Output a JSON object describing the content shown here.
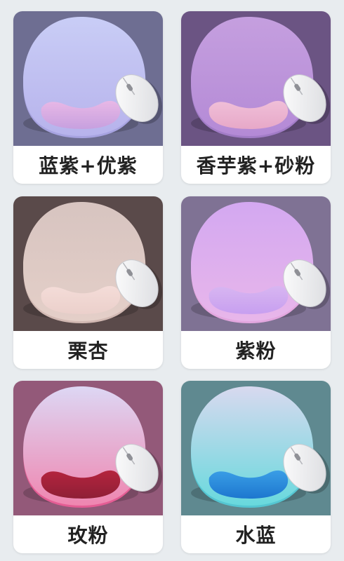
{
  "products": [
    {
      "label": "蓝紫+优紫",
      "colors": {
        "bg": "#6e6e92",
        "pad_top": "#c9cdf6",
        "pad_bottom": "#b7b3ec",
        "rest_top": "#e8b8e6",
        "rest_bottom": "#c7a0df",
        "rim": "#a7a3e0"
      }
    },
    {
      "label": "香芋紫+砂粉",
      "colors": {
        "bg": "#6b5483",
        "pad_top": "#c59fdf",
        "pad_bottom": "#b48ad6",
        "rest_top": "#f0bfd8",
        "rest_bottom": "#e7a8c8",
        "rim": "#a27cc7"
      }
    },
    {
      "label": "栗杏",
      "colors": {
        "bg": "#5a4a4a",
        "pad_top": "#d7c4c0",
        "pad_bottom": "#e4cfc8",
        "rest_top": "#f4dcd8",
        "rest_bottom": "#ebd0cb",
        "rim": "#d2b9b3"
      }
    },
    {
      "label": "紫粉",
      "colors": {
        "bg": "#7f7294",
        "pad_top": "#d3a8f1",
        "pad_bottom": "#e8b6ea",
        "rest_top": "#d8b6f1",
        "rest_bottom": "#c79ff0",
        "rim": "#e3a7df"
      }
    },
    {
      "label": "玫粉",
      "colors": {
        "bg": "#935979",
        "pad_top": "#ddd7f4",
        "pad_bottom": "#ef86b0",
        "rest_top": "#b4243e",
        "rest_bottom": "#8f1f36",
        "rim": "#e45d94"
      }
    },
    {
      "label": "水蓝",
      "colors": {
        "bg": "#5f8990",
        "pad_top": "#d8d9ef",
        "pad_bottom": "#68d9dd",
        "rest_top": "#3a9ee6",
        "rest_bottom": "#1d77cf",
        "rim": "#55c6d2"
      }
    }
  ]
}
